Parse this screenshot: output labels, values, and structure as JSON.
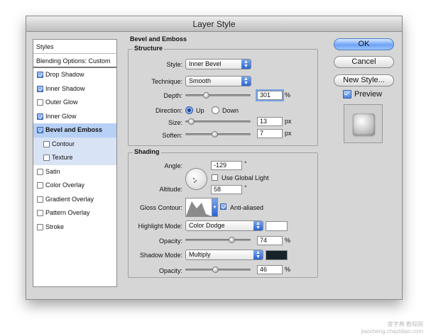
{
  "window": {
    "title": "Layer Style"
  },
  "styles_panel": {
    "header": "Styles",
    "blending": "Blending Options: Custom",
    "items": [
      {
        "label": "Drop Shadow",
        "checked": true
      },
      {
        "label": "Inner Shadow",
        "checked": true
      },
      {
        "label": "Outer Glow",
        "checked": false
      },
      {
        "label": "Inner Glow",
        "checked": true
      },
      {
        "label": "Bevel and Emboss",
        "checked": true,
        "selected": true
      },
      {
        "label": "Contour",
        "checked": false,
        "sub": true
      },
      {
        "label": "Texture",
        "checked": false,
        "sub": true
      },
      {
        "label": "Satin",
        "checked": false
      },
      {
        "label": "Color Overlay",
        "checked": false
      },
      {
        "label": "Gradient Overlay",
        "checked": false
      },
      {
        "label": "Pattern Overlay",
        "checked": false
      },
      {
        "label": "Stroke",
        "checked": false
      }
    ]
  },
  "bevel": {
    "title": "Bevel and Emboss",
    "structure": {
      "legend": "Structure",
      "style_label": "Style:",
      "style_value": "Inner Bevel",
      "technique_label": "Technique:",
      "technique_value": "Smooth",
      "depth_label": "Depth:",
      "depth_value": "301",
      "depth_unit": "%",
      "depth_slider": 0.3,
      "direction_label": "Direction:",
      "dir_up": "Up",
      "dir_down": "Down",
      "direction": "up",
      "size_label": "Size:",
      "size_value": "13",
      "size_unit": "px",
      "size_slider": 0.05,
      "soften_label": "Soften:",
      "soften_value": "7",
      "soften_unit": "px",
      "soften_slider": 0.45
    },
    "shading": {
      "legend": "Shading",
      "angle_label": "Angle:",
      "angle_value": "-129",
      "angle_unit": "°",
      "global_light_label": "Use Global Light",
      "global_light": false,
      "altitude_label": "Altitude:",
      "altitude_value": "58",
      "altitude_unit": "°",
      "gloss_label": "Gloss Contour:",
      "anti_aliased_label": "Anti-aliased",
      "anti_aliased": true,
      "highlight_label": "Highlight Mode:",
      "highlight_mode": "Color Dodge",
      "highlight_color": "#ffffff",
      "h_opacity_label": "Opacity:",
      "h_opacity_value": "74",
      "h_opacity_unit": "%",
      "h_opacity_slider": 0.74,
      "shadow_label": "Shadow Mode:",
      "shadow_mode": "Multiply",
      "shadow_color": "#17232b",
      "s_opacity_label": "Opacity:",
      "s_opacity_value": "46",
      "s_opacity_unit": "%",
      "s_opacity_slider": 0.46
    }
  },
  "buttons": {
    "ok": "OK",
    "cancel": "Cancel",
    "new_style": "New Style...",
    "preview_label": "Preview",
    "preview": true
  },
  "watermark": {
    "line1": "查字典 教程网",
    "line2": "jiaocheng.chazidian.com"
  }
}
